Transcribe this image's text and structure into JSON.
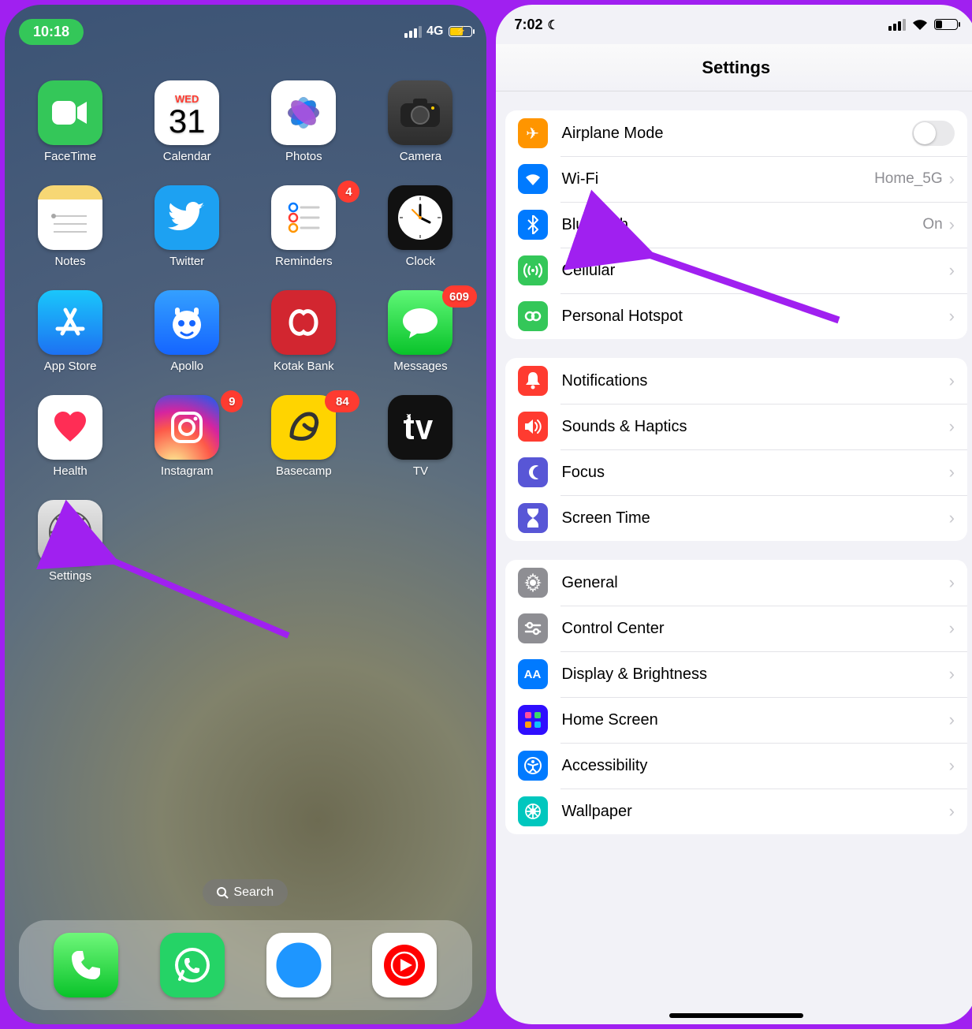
{
  "home": {
    "time": "10:18",
    "network_label": "4G",
    "calendar": {
      "weekday": "WED",
      "day": "31"
    },
    "apps": {
      "facetime": "FaceTime",
      "calendar": "Calendar",
      "photos": "Photos",
      "camera": "Camera",
      "notes": "Notes",
      "twitter": "Twitter",
      "reminders": "Reminders",
      "clock": "Clock",
      "appstore": "App Store",
      "apollo": "Apollo",
      "kotak": "Kotak Bank",
      "messages": "Messages",
      "health": "Health",
      "instagram": "Instagram",
      "basecamp": "Basecamp",
      "tv": "TV",
      "settings": "Settings"
    },
    "badges": {
      "reminders": "4",
      "messages": "609",
      "instagram": "9",
      "basecamp": "84"
    },
    "search": "Search"
  },
  "settings": {
    "time": "7:02",
    "title": "Settings",
    "rows": {
      "airplane": "Airplane Mode",
      "wifi": "Wi-Fi",
      "wifi_val": "Home_5G",
      "bluetooth": "Bluetooth",
      "bt_val": "On",
      "cellular": "Cellular",
      "hotspot": "Personal Hotspot",
      "notifications": "Notifications",
      "sounds": "Sounds & Haptics",
      "focus": "Focus",
      "screentime": "Screen Time",
      "general": "General",
      "controlcenter": "Control Center",
      "display": "Display & Brightness",
      "homescreen": "Home Screen",
      "accessibility": "Accessibility",
      "wallpaper": "Wallpaper"
    }
  }
}
